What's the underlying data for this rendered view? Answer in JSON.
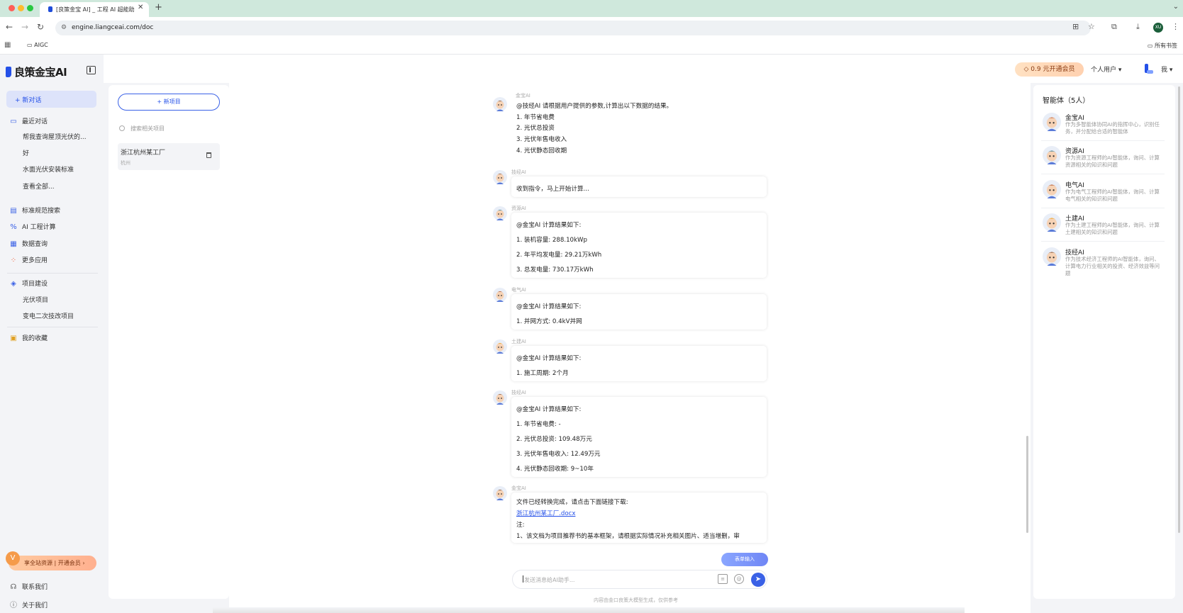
{
  "browser": {
    "tab_title": "[良策金宝 AI] _ 工程 AI 超能助",
    "tab_close": "✕",
    "new_tab": "+",
    "url": "engine.liangceai.com/doc",
    "account_initials": "XU",
    "bookmark_folder": "AIGC",
    "all_bookmarks": "所有书签"
  },
  "header": {
    "logo_text": "良策金宝AI",
    "vip_label": "0.9 元开通会员",
    "user_type": "个人用户 ▾",
    "me_label": "我 ▾"
  },
  "sidebar": {
    "new_chat": "新对话",
    "recent_label": "最近对话",
    "recent_items": [
      "帮我查询屋顶光伏的...",
      "好",
      "水面光伏安装标准",
      "查看全部..."
    ],
    "tools": [
      {
        "icon": "document-search-icon",
        "glyph": "▤",
        "color": "#3a61e6",
        "label": "标准规范搜索"
      },
      {
        "icon": "calculator-icon",
        "glyph": "%",
        "color": "#3a61e6",
        "label": "AI 工程计算"
      },
      {
        "icon": "data-query-icon",
        "glyph": "▦",
        "color": "#3a61e6",
        "label": "数据查询"
      },
      {
        "icon": "apps-grid-icon",
        "glyph": "⁘",
        "color": "#f0603a",
        "label": "更多应用"
      }
    ],
    "project_label": "项目建设",
    "project_items": [
      "光伏项目",
      "变电二次技改项目"
    ],
    "favorites_label": "我的收藏",
    "promo": "享全站资源 | 开通会员 ›",
    "contact": "联系我们",
    "about": "关于我们"
  },
  "projects": {
    "new_button": "+ 新项目",
    "search_placeholder": "搜索相关项目",
    "item_name": "浙江杭州某工厂",
    "item_city": "杭州"
  },
  "chat": {
    "messages": [
      {
        "sender": "金宝AI",
        "lines": [
          "@技经AI 请根据用户提供的参数,计算出以下数据的结果。",
          "1. 年节省电费",
          "2. 光伏总投资",
          "3. 光伏年售电收入",
          "4. 光伏静态回收期"
        ]
      },
      {
        "sender": "技经AI",
        "lines": [
          "收到指令，马上开始计算..."
        ]
      },
      {
        "sender": "资源AI",
        "lines": [
          "@金宝AI 计算结果如下:",
          "1. 装机容量: 288.10kWp",
          "2. 年平均发电量: 29.21万kWh",
          "3. 总发电量: 730.17万kWh"
        ]
      },
      {
        "sender": "电气AI",
        "lines": [
          "@金宝AI 计算结果如下:",
          "1. 并网方式: 0.4kV并网"
        ]
      },
      {
        "sender": "土建AI",
        "lines": [
          "@金宝AI 计算结果如下:",
          "1. 施工周期: 2个月"
        ]
      },
      {
        "sender": "技经AI",
        "lines": [
          "@金宝AI 计算结果如下:",
          "1. 年节省电费: -",
          "2. 光伏总投资: 109.48万元",
          "3. 光伏年售电收入: 12.49万元",
          "4. 光伏静态回收期: 9~10年"
        ]
      },
      {
        "sender": "金宝AI",
        "lines": [
          "文件已经转换完成，请点击下面链接下载:",
          "浙江杭州某工厂.docx",
          "注:",
          "1、该文档为项目推荐书的基本框架，请根据实际情况补充相关图片、适当增删，审"
        ]
      }
    ],
    "form_input_button": "表单输入",
    "input_placeholder": "发送消息给AI助手...",
    "disclaimer": "内容由金口良策大模型生成，仅供参考"
  },
  "agents": {
    "title": "智能体（5人）",
    "list": [
      {
        "name": "金宝AI",
        "desc": "作为多智能体协同AI的指挥中心，识别任务，并分配给合适的智能体",
        "color": "#c86a3c"
      },
      {
        "name": "资源AI",
        "desc": "作为资源工程师的AI智能体，询问、计算资源相关的知识和问题",
        "color": "#3d7f93"
      },
      {
        "name": "电气AI",
        "desc": "作为电气工程师的AI智能体，询问、计算电气相关的知识和问题",
        "color": "#b45a32"
      },
      {
        "name": "土建AI",
        "desc": "作为土建工程师的AI智能体，询问、计算土建相关的知识和问题",
        "color": "#f0a321"
      },
      {
        "name": "技经AI",
        "desc": "作为技术经济工程师的AI智能体，询问、计算电力行业相关的投资、经济效益等问题",
        "color": "#8f5a3a"
      }
    ]
  }
}
